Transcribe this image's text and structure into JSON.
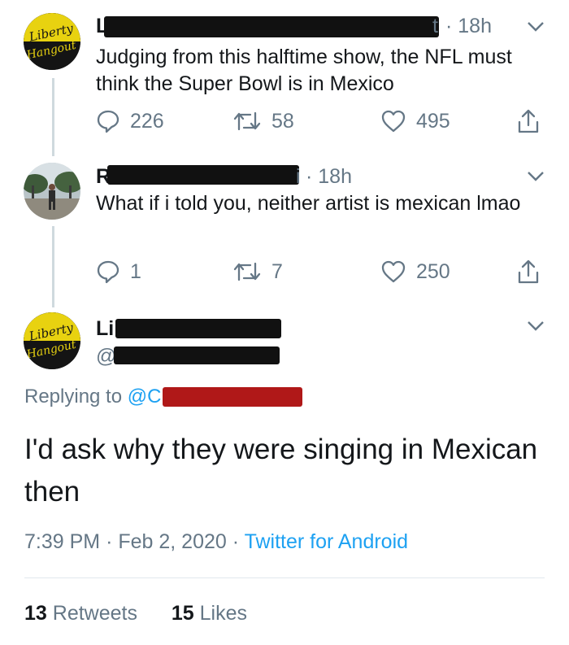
{
  "tweets": [
    {
      "author_stub": "L",
      "handle_tail": "t",
      "time": "· 18h",
      "text": "Judging from this halftime show, the NFL must think the Super Bowl is in Mexico",
      "replies": "226",
      "retweets": "58",
      "likes": "495"
    },
    {
      "author_stub": "R",
      "handle_tail": "i",
      "time": "· 18h",
      "text": "What if i told you, neither artist is mexican lmao",
      "replies": "1",
      "retweets": "7",
      "likes": "250"
    }
  ],
  "main_tweet": {
    "author_stub": "Li",
    "handle_stub": "@",
    "replying_label": "Replying to",
    "replying_mention": "@C",
    "text": "I'd ask why they were singing in Mexican then",
    "time": "7:39 PM",
    "date": "Feb 2, 2020",
    "separator": "·",
    "source": "Twitter for Android",
    "retweets_count": "13",
    "retweets_label": "Retweets",
    "likes_count": "15",
    "likes_label": "Likes"
  },
  "logo_text": [
    "Liberty",
    "Hangout"
  ],
  "colors": {
    "link": "#1da1f2",
    "muted": "#657786",
    "text": "#14171a",
    "logo_yellow": "#e8d210"
  }
}
